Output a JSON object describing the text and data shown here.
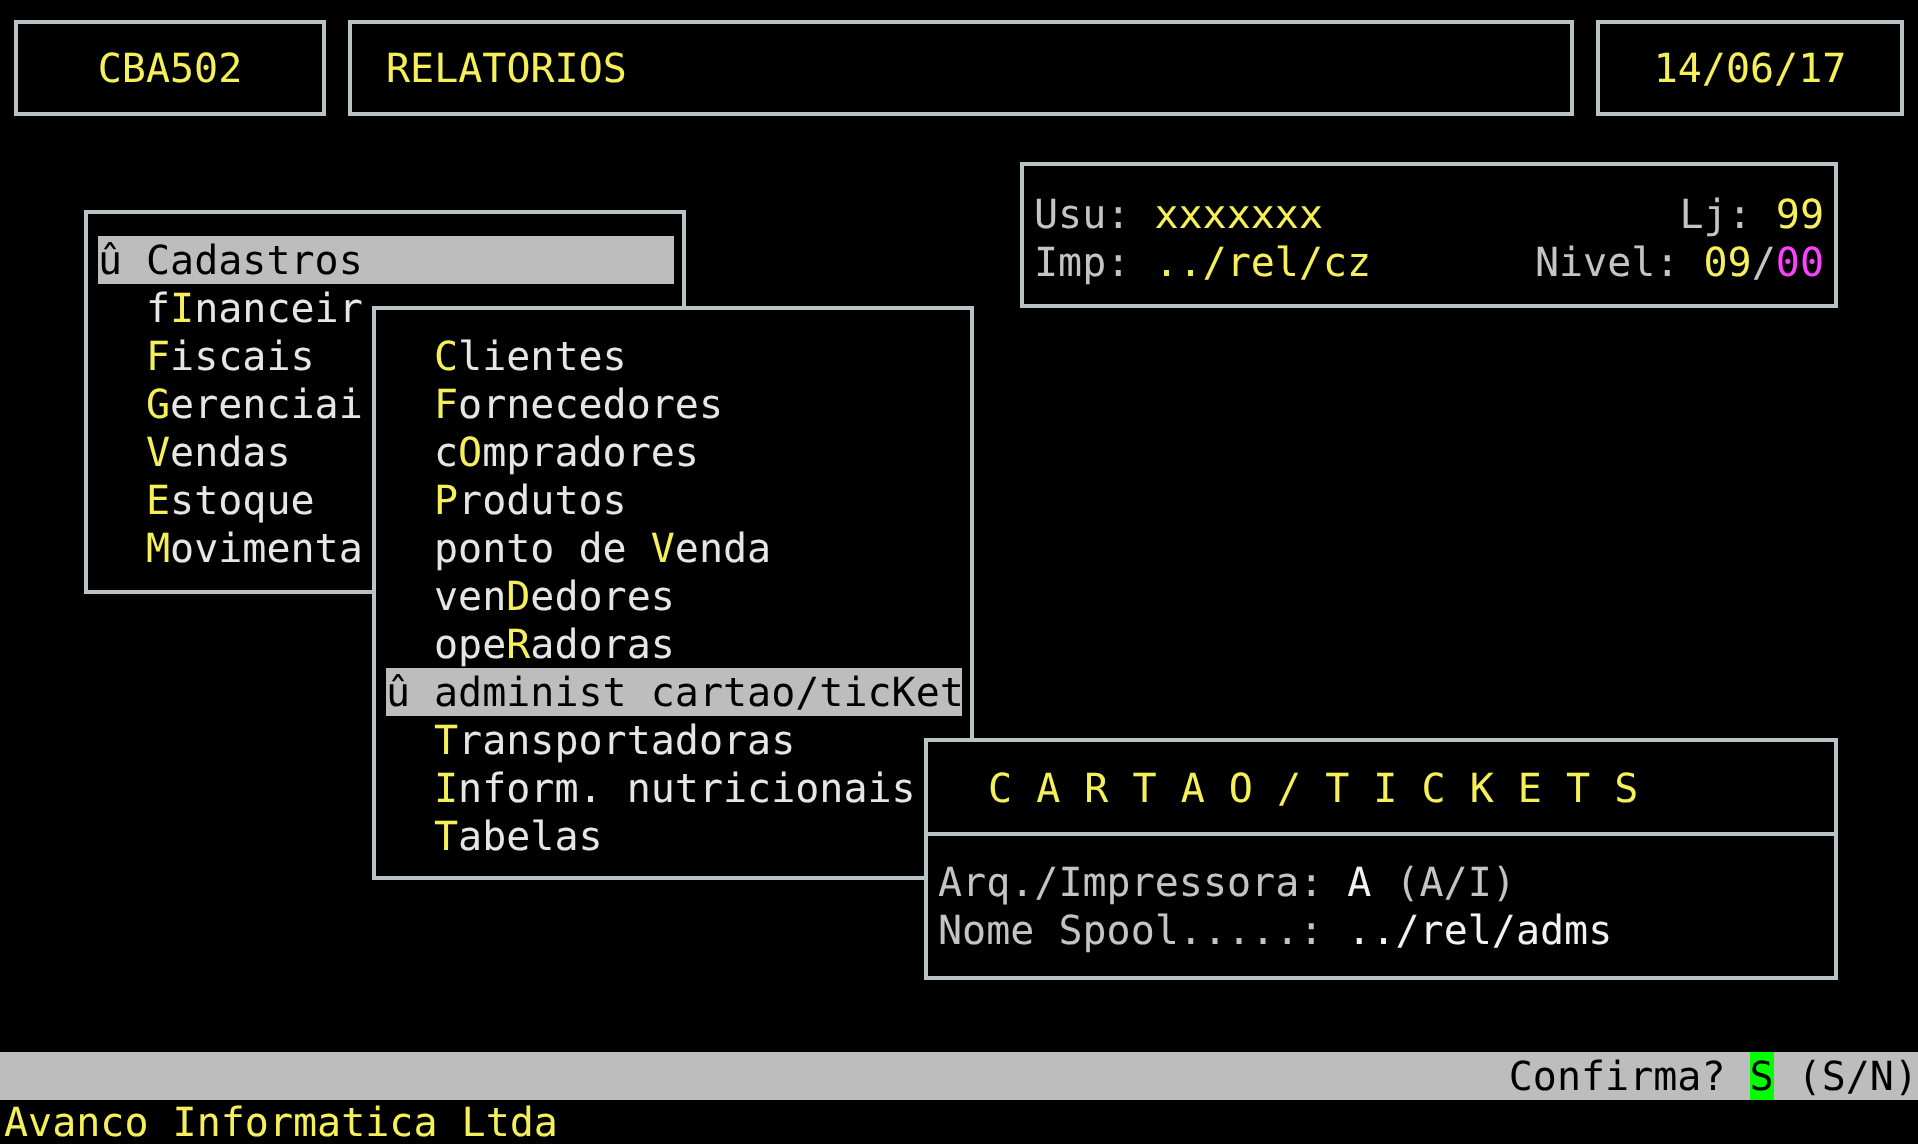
{
  "header": {
    "program": "CBA502",
    "title": "RELATORIOS",
    "date": "14/06/17"
  },
  "info": {
    "user": {
      "label": "Usu:",
      "value": "xxxxxxx"
    },
    "store": {
      "label": "Lj:",
      "value": "99"
    },
    "printer": {
      "label": "Imp:",
      "value": "../rel/cz"
    },
    "level": {
      "label": "Nivel:",
      "value": "09",
      "separator": "/",
      "sub_value": "00"
    }
  },
  "main_menu": {
    "selection_marker": "û",
    "items": [
      {
        "key": "C",
        "after": "adastros",
        "selected": true
      },
      {
        "before": "f",
        "key": "I",
        "after": "nanceir",
        "selected": false
      },
      {
        "key": "F",
        "after": "iscais",
        "selected": false
      },
      {
        "key": "G",
        "after": "erenciai",
        "selected": false
      },
      {
        "key": "V",
        "after": "endas",
        "selected": false
      },
      {
        "key": "E",
        "after": "stoque",
        "selected": false
      },
      {
        "key": "M",
        "after": "ovimenta",
        "selected": false
      }
    ]
  },
  "sub_menu": {
    "selection_marker": "û",
    "items": [
      {
        "key": "C",
        "after": "lientes",
        "selected": false
      },
      {
        "key": "F",
        "after": "ornecedores",
        "selected": false
      },
      {
        "before": "c",
        "key": "O",
        "after": "mpradores",
        "selected": false
      },
      {
        "key": "P",
        "after": "rodutos",
        "selected": false
      },
      {
        "before": "ponto de ",
        "key": "V",
        "after": "enda",
        "selected": false
      },
      {
        "before": "ven",
        "key": "D",
        "after": "edores",
        "selected": false
      },
      {
        "before": "ope",
        "key": "R",
        "after": "adoras",
        "selected": false
      },
      {
        "before": "administ cartao/tic",
        "key": "K",
        "after": "et",
        "selected": true
      },
      {
        "key": "T",
        "after": "ransportadoras",
        "selected": false
      },
      {
        "key": "I",
        "after": "nform. nutricionais",
        "selected": false
      },
      {
        "key": "T",
        "after": "abelas",
        "selected": false
      }
    ]
  },
  "dialog": {
    "title": "C A R T A O / T I C K E T S",
    "fields": [
      {
        "label": "Arq./Impressora:",
        "value": "A",
        "hint": "(A/I)"
      },
      {
        "label": "Nome Spool.....:",
        "value": "../rel/adms"
      }
    ]
  },
  "status_bar": {
    "prompt": "Confirma?",
    "answer": "S",
    "options": "(S/N)"
  },
  "footer": "Avanco Informatica Ltda"
}
